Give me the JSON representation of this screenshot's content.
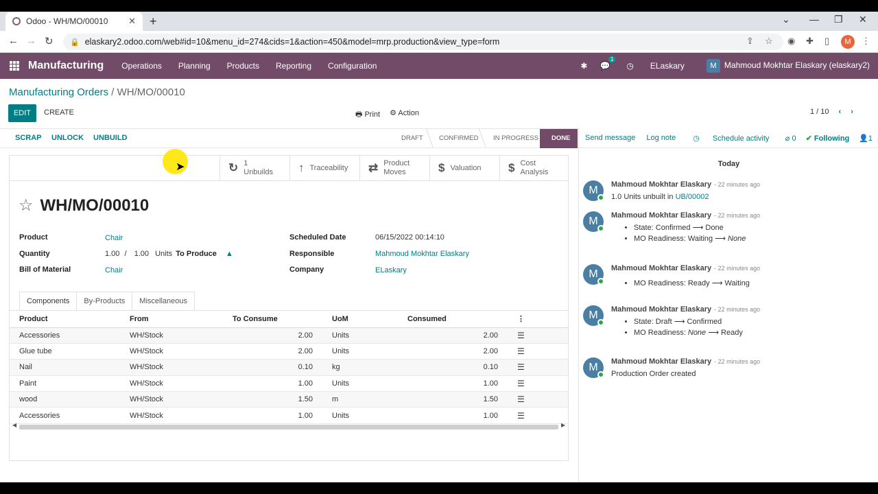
{
  "browser": {
    "tab_title": "Odoo - WH/MO/00010",
    "url": "elaskary2.odoo.com/web#id=10&menu_id=274&cids=1&action=450&model=mrp.production&view_type=form",
    "profile_initial": "M"
  },
  "navbar": {
    "app_name": "Manufacturing",
    "menu": [
      "Operations",
      "Planning",
      "Products",
      "Reporting",
      "Configuration"
    ],
    "message_count": "1",
    "company": "ELaskary",
    "user_initial": "M",
    "user": "Mahmoud Mokhtar Elaskary (elaskary2)"
  },
  "breadcrumb": {
    "parent": "Manufacturing Orders",
    "separator": " / ",
    "current": "WH/MO/00010"
  },
  "control": {
    "edit": "EDIT",
    "create": "CREATE",
    "print": "Print",
    "action": "Action",
    "pager": "1 / 10"
  },
  "statusbar": {
    "buttons": [
      "SCRAP",
      "UNLOCK",
      "UNBUILD"
    ],
    "stages": [
      "DRAFT",
      "CONFIRMED",
      "IN PROGRESS",
      "DONE"
    ]
  },
  "smart_buttons": [
    {
      "icon": "↻",
      "line1": "1",
      "line2": "Unbuilds"
    },
    {
      "icon": "↑",
      "line1": "Traceability",
      "line2": ""
    },
    {
      "icon": "⇄",
      "line1": "Product",
      "line2": "Moves"
    },
    {
      "icon": "$",
      "line1": "Valuation",
      "line2": ""
    },
    {
      "icon": "$",
      "line1": "Cost",
      "line2": "Analysis"
    }
  ],
  "record": {
    "name": "WH/MO/00010",
    "product_label": "Product",
    "product": "Chair",
    "quantity_label": "Quantity",
    "qty_done": "1.00",
    "qty_sep": "/",
    "qty_total": "1.00",
    "uom": "Units",
    "to_produce": "To Produce",
    "bom_label": "Bill of Material",
    "bom": "Chair",
    "date_label": "Scheduled Date",
    "date": "06/15/2022 00:14:10",
    "responsible_label": "Responsible",
    "responsible": "Mahmoud Mokhtar Elaskary",
    "company_label": "Company",
    "company": "ELaskary"
  },
  "tabs": [
    "Components",
    "By-Products",
    "Miscellaneous"
  ],
  "table": {
    "headers": [
      "Product",
      "From",
      "To Consume",
      "UoM",
      "Consumed"
    ],
    "rows": [
      [
        "Accessories",
        "WH/Stock",
        "2.00",
        "Units",
        "2.00"
      ],
      [
        "Glue tube",
        "WH/Stock",
        "2.00",
        "Units",
        "2.00"
      ],
      [
        "Nail",
        "WH/Stock",
        "0.10",
        "kg",
        "0.10"
      ],
      [
        "Paint",
        "WH/Stock",
        "1.00",
        "Units",
        "1.00"
      ],
      [
        "wood",
        "WH/Stock",
        "1.50",
        "m",
        "1.50"
      ],
      [
        "Accessories",
        "WH/Stock",
        "1.00",
        "Units",
        "1.00"
      ]
    ]
  },
  "chatter": {
    "send": "Send message",
    "log": "Log note",
    "schedule": "Schedule activity",
    "attachments": "0",
    "following": "Following",
    "followers": "1",
    "today": "Today",
    "author": "Mahmoud Mokhtar Elaskary",
    "ago": "- 22 minutes ago",
    "msg1_text": "1.0 Units unbuilt in ",
    "msg1_link": "UB/00002",
    "msg2_l1": "State: Confirmed ⟶ Done",
    "msg2_l2a": "MO Readiness: Waiting ⟶ ",
    "msg2_l2b": "None",
    "msg3_l1": "MO Readiness: Ready ⟶ Waiting",
    "msg4_l1": "State: Draft ⟶ Confirmed",
    "msg4_l2a": "MO Readiness: ",
    "msg4_l2b": "None",
    "msg4_l2c": " ⟶ Ready",
    "msg5_text": "Production Order created"
  },
  "colors": {
    "brand": "#714b67",
    "accent": "#017e84"
  }
}
